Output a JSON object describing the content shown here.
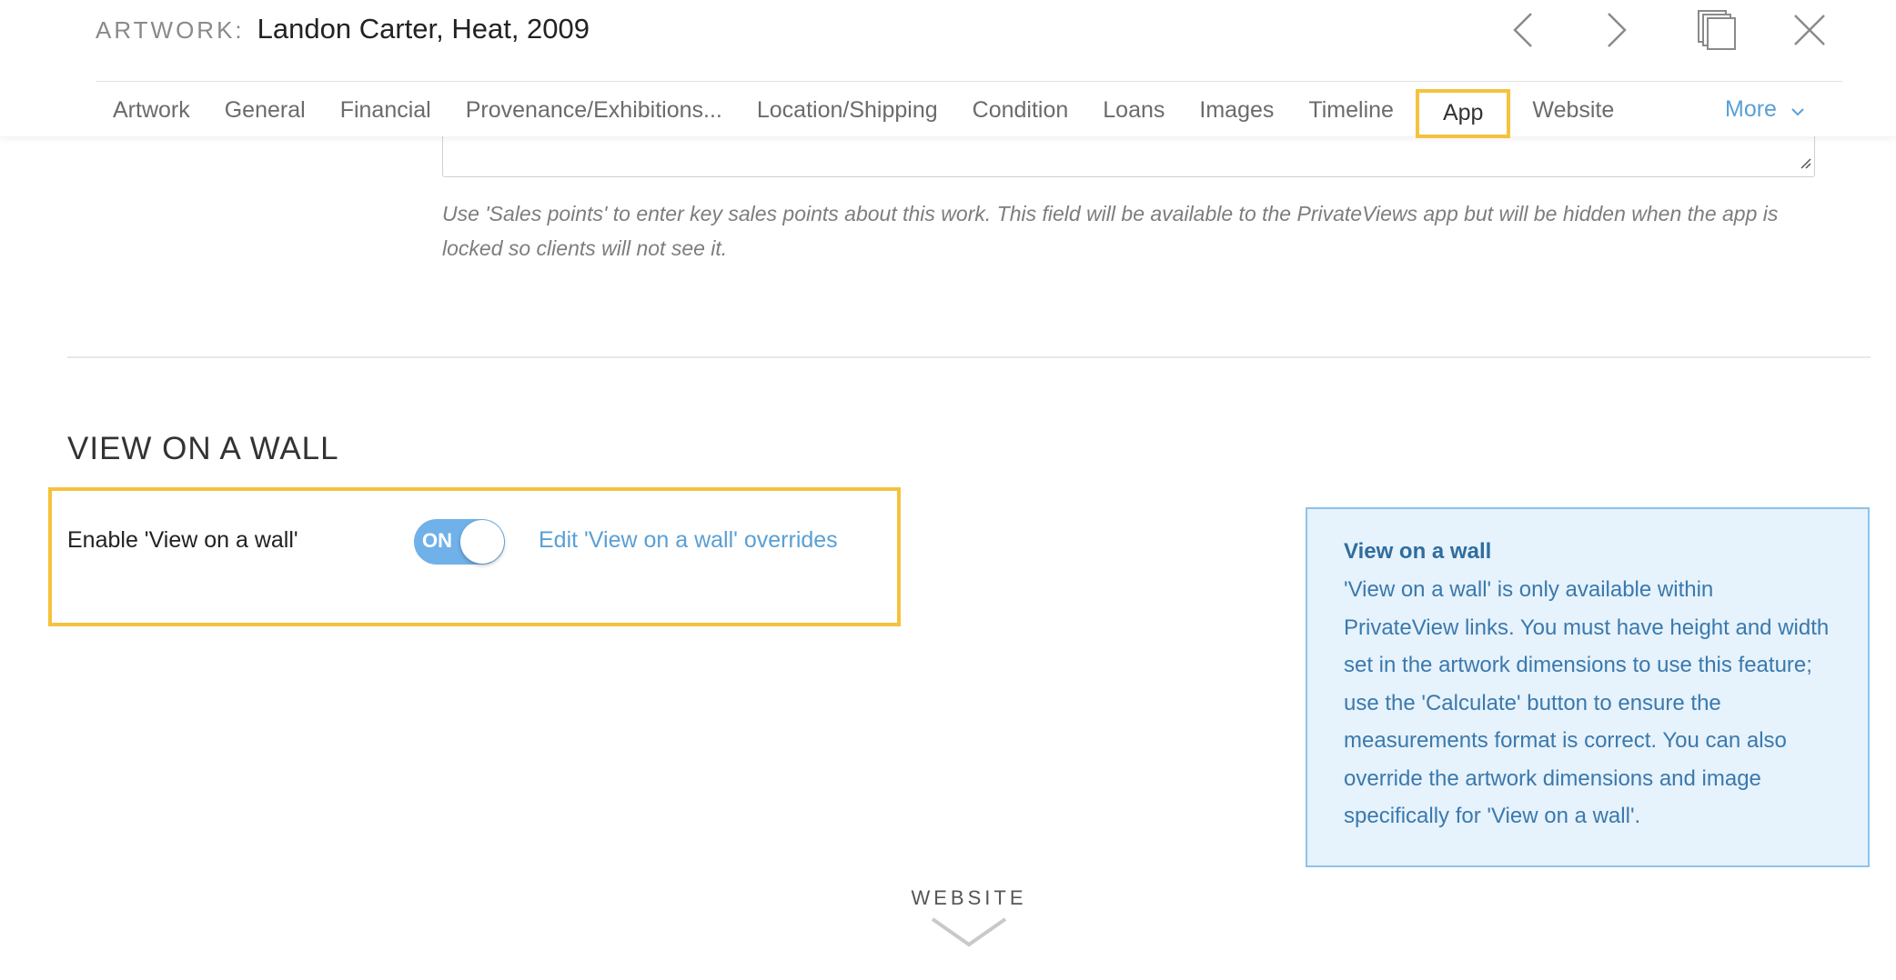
{
  "header": {
    "title_label": "ARTWORK:",
    "title_value": "Landon Carter, Heat, 2009",
    "icons": [
      "chevron-left-icon",
      "chevron-right-icon",
      "copy-icon",
      "close-icon"
    ]
  },
  "tabs": [
    {
      "label": "Artwork",
      "active": false
    },
    {
      "label": "General",
      "active": false
    },
    {
      "label": "Financial",
      "active": false
    },
    {
      "label": "Provenance/Exhibitions...",
      "active": false
    },
    {
      "label": "Location/Shipping",
      "active": false
    },
    {
      "label": "Condition",
      "active": false
    },
    {
      "label": "Loans",
      "active": false
    },
    {
      "label": "Images",
      "active": false
    },
    {
      "label": "Timeline",
      "active": false
    },
    {
      "label": "App",
      "active": true
    },
    {
      "label": "Website",
      "active": false
    }
  ],
  "more_tab": {
    "label": "More"
  },
  "sales_points": {
    "help_text": "Use 'Sales points' to enter key sales points about this work. This field will be available to the PrivateViews app but will be hidden when the app is locked so clients will not see it."
  },
  "view_on_wall": {
    "section_title": "VIEW ON A WALL",
    "enable_label": "Enable 'View on a wall'",
    "toggle_label": "ON",
    "edit_link": "Edit 'View on a wall' overrides",
    "info_title": "View on a wall",
    "info_body": "'View on a wall' is only available within PrivateView links. You must have height and width set in the artwork dimensions to use this feature; use the 'Calculate' button to ensure the measurements format is correct. You can also override the artwork dimensions and image specifically for 'View on a wall'."
  },
  "footer": {
    "next_section_label": "WEBSITE"
  },
  "colors": {
    "accent_blue": "#5a9fd4",
    "highlight_yellow": "#f5c23e",
    "toggle_on": "#6fb1e8",
    "info_bg": "#e6f2fc"
  }
}
